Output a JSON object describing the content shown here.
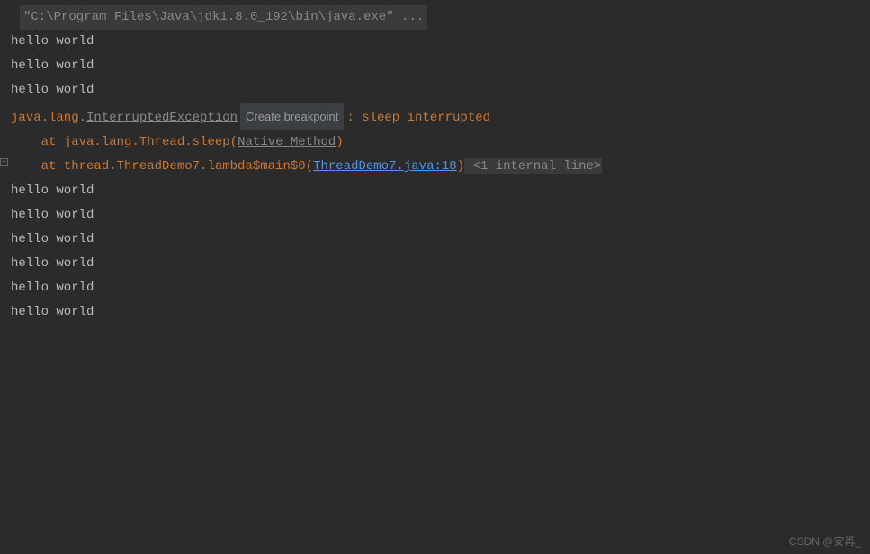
{
  "command": "\"C:\\Program Files\\Java\\jdk1.8.0_192\\bin\\java.exe\" ...",
  "hello_before": [
    "hello world",
    "hello world",
    "hello world"
  ],
  "exception": {
    "package": "java.lang.",
    "name": "InterruptedException",
    "breakpoint_label": "Create breakpoint",
    "message_sep": ": ",
    "message": "sleep interrupted"
  },
  "stack": [
    {
      "prefix": "    at ",
      "method": "java.lang.Thread.sleep",
      "open": "(",
      "link": "Native Method",
      "link_type": "native",
      "close": ")",
      "tail": ""
    },
    {
      "prefix": "    at ",
      "method": "thread.ThreadDemo7.lambda$main$0",
      "open": "(",
      "link": "ThreadDemo7.java:18",
      "link_type": "source",
      "close": ")",
      "tail": " <1 internal line>"
    }
  ],
  "hello_after": [
    "hello world",
    "hello world",
    "hello world",
    "hello world",
    "hello world",
    "hello world"
  ],
  "watermark": "CSDN @安苒_",
  "fold_symbol": "+"
}
